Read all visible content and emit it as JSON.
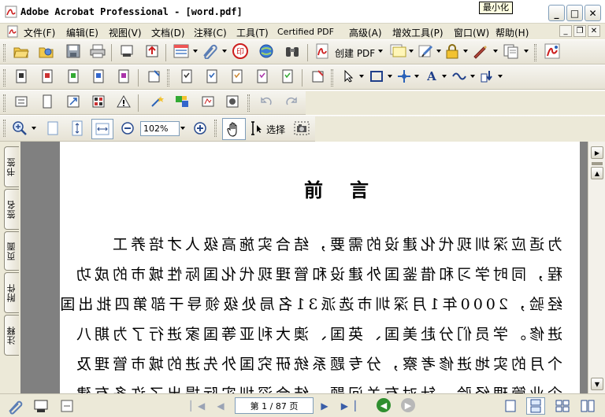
{
  "window": {
    "title": "Adobe Acrobat Professional - [word.pdf]",
    "tooltip": "最小化",
    "minimize": "_",
    "maximize": "□",
    "close": "✕"
  },
  "menu": {
    "items": [
      "文件(F)",
      "编辑(E)",
      "视图(V)",
      "文档(D)",
      "注释(C)",
      "工具(T)",
      "Certified PDF",
      "高级(A)",
      "增效工具(P)",
      "窗口(W)",
      "帮助(H)"
    ],
    "doc_minimize": "_",
    "doc_restore": "❐",
    "doc_close": "✕"
  },
  "toolbar": {
    "create_pdf": "创建 PDF",
    "zoom_value": "102%",
    "select_label": "选择"
  },
  "sidebar": {
    "tabs": [
      "书签",
      "签名",
      "页面",
      "附件",
      "注释"
    ]
  },
  "document": {
    "heading": "前言",
    "lines": [
      "为适应深圳现代化建设的需要，结合实施高级人才培养工",
      "程，同时学习和借鉴国外建设和管理现代化国际性城市的成功",
      "经验，2000年1月深圳市选派31名局处级领导干部第四批出国",
      "进修。学员们分赴美国、英国、澳大利亚等国家进行了为期八",
      "个月的实地进修考察，分专题系统研究国外先进的城市管理及",
      "企业管理经验，针对有关问题，结合深圳实际提出了许多有建"
    ]
  },
  "status": {
    "page_indicator": "第 1 / 87 页"
  },
  "colors": {
    "accent": "#3a5ea8",
    "title_bg": "#ffffff",
    "chrome": "#ece9d8",
    "doc_bg": "#808080",
    "pdf_red": "#cc1d1d"
  }
}
